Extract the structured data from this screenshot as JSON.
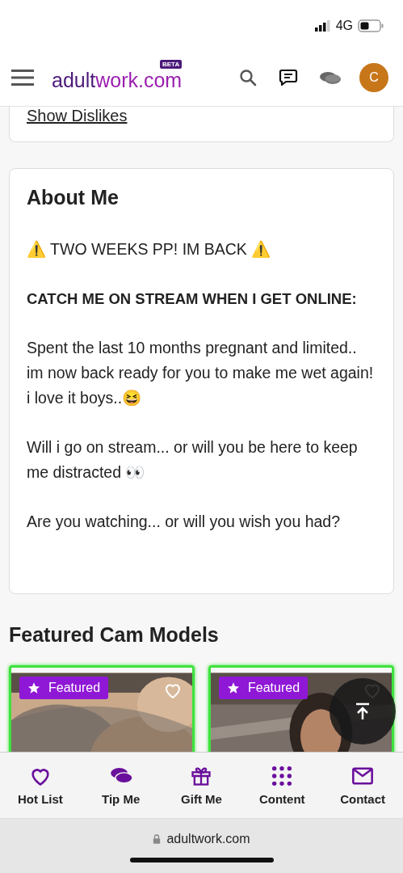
{
  "status_bar": {
    "network": "4G"
  },
  "header": {
    "logo_prefix": "adult",
    "logo_suffix": "work.com",
    "logo_badge": "BETA",
    "avatar_letter": "C"
  },
  "previous_card": {
    "link": "Show Dislikes"
  },
  "about": {
    "title": "About Me",
    "paragraphs": [
      {
        "kind": "text",
        "text": "⚠️ TWO WEEKS PP! IM BACK ⚠️"
      },
      {
        "kind": "bold",
        "text": "CATCH ME ON STREAM WHEN I GET ONLINE:"
      },
      {
        "kind": "text",
        "text": "Spent the last 10 months pregnant and limited.. im now back ready for you to make me wet again! i love it boys..😆"
      },
      {
        "kind": "text",
        "text": "Will i go on stream... or will you be here to keep me distracted 👀"
      },
      {
        "kind": "text",
        "text": "Are you watching... or will you wish you had?"
      }
    ]
  },
  "featured": {
    "title": "Featured Cam Models",
    "models": [
      {
        "badge": "Featured"
      },
      {
        "badge": "Featured"
      }
    ]
  },
  "bottom_nav": [
    {
      "kind": "heart",
      "label": "Hot List"
    },
    {
      "kind": "coins",
      "label": "Tip Me"
    },
    {
      "kind": "gift",
      "label": "Gift Me"
    },
    {
      "kind": "grid",
      "label": "Content"
    },
    {
      "kind": "mail",
      "label": "Contact"
    }
  ],
  "browser_bar": {
    "url": "adultwork.com"
  }
}
